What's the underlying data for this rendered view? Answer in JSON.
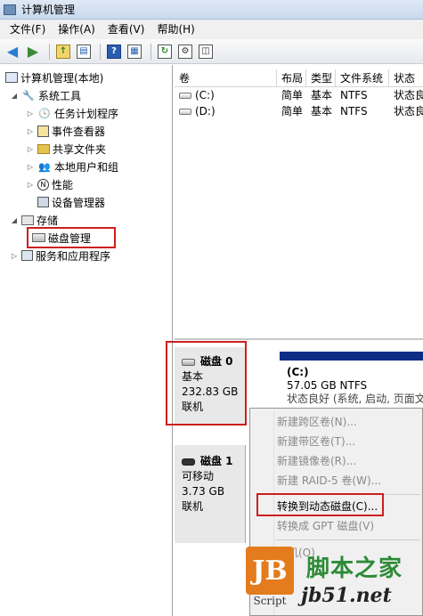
{
  "window": {
    "title": "计算机管理"
  },
  "menu": [
    "文件(F)",
    "操作(A)",
    "查看(V)",
    "帮助(H)"
  ],
  "toolbar": {
    "icons": [
      "back-arrow-icon",
      "forward-arrow-icon",
      "up-folder-icon",
      "show-hide-tree-icon",
      "help-icon",
      "properties-icon",
      "refresh-icon",
      "settings-icon",
      "disk-icon"
    ]
  },
  "tree": {
    "root": "计算机管理(本地)",
    "system_tools": "系统工具",
    "task_scheduler": "任务计划程序",
    "event_viewer": "事件查看器",
    "shared_folders": "共享文件夹",
    "local_users": "本地用户和组",
    "performance": "性能",
    "device_manager": "设备管理器",
    "storage": "存储",
    "disk_management": "磁盘管理",
    "services_apps": "服务和应用程序"
  },
  "volumes": {
    "columns": [
      "卷",
      "布局",
      "类型",
      "文件系统",
      "状态"
    ],
    "rows": [
      {
        "name": "(C:)",
        "layout": "简单",
        "type": "基本",
        "fs": "NTFS",
        "status": "状态良好"
      },
      {
        "name": "(D:)",
        "layout": "简单",
        "type": "基本",
        "fs": "NTFS",
        "status": "状态良好"
      }
    ]
  },
  "disks": [
    {
      "name": "磁盘 0",
      "type": "基本",
      "size": "232.83 GB",
      "state": "联机"
    },
    {
      "name": "磁盘 1",
      "type": "可移动",
      "size": "3.73 GB",
      "state": "联机"
    }
  ],
  "partition": {
    "label": "(C:)",
    "size": "57.05 GB NTFS",
    "status": "状态良好 (系统, 启动, 页面文件"
  },
  "context_menu": {
    "items": [
      {
        "label": "新建跨区卷(N)...",
        "enabled": false
      },
      {
        "label": "新建带区卷(T)...",
        "enabled": false
      },
      {
        "label": "新建镜像卷(R)...",
        "enabled": false
      },
      {
        "label": "新建 RAID-5 卷(W)...",
        "enabled": false
      },
      {
        "label": "转换到动态磁盘(C)...",
        "enabled": true
      },
      {
        "label": "转换成 GPT 磁盘(V)",
        "enabled": false
      },
      {
        "label": "脱机(O)",
        "enabled": false
      }
    ]
  },
  "watermark": {
    "logo": "JB",
    "script": "Script",
    "site_name": "脚本之家",
    "url": "jb51.net"
  },
  "colors": {
    "highlight_red": "#cc1f1f",
    "partition_bar": "#102d86"
  }
}
